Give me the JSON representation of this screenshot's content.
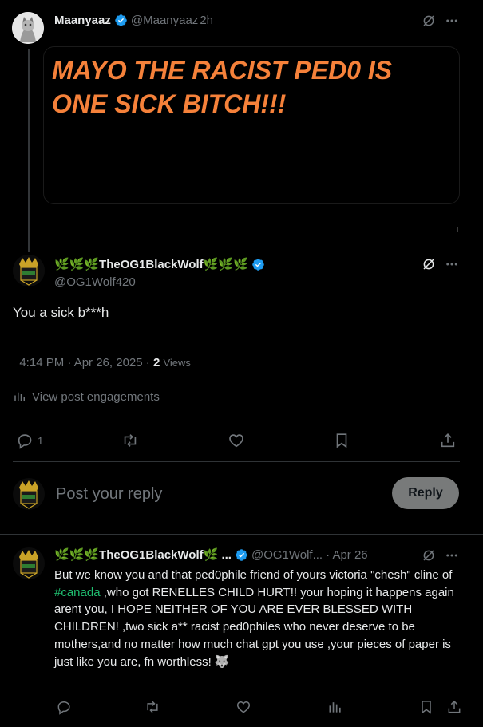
{
  "parent_post": {
    "display_name": "Maanyaaz",
    "handle": "@Maanyaaz",
    "time_ago": "2h",
    "headline_line1": "MAYO THE RACIST PED0 IS",
    "headline_line2": "ONE SICK BITCH!!!",
    "headline_color": "#f5813a"
  },
  "main_post": {
    "display_name": "🌿🌿🌿TheOG1BlackWolf🌿🌿🌿",
    "handle": "@OG1Wolf420",
    "text": "You a sick b***h",
    "timestamp": "4:14 PM · Apr 26, 2025 · ",
    "views_count": "2",
    "views_label": "Views",
    "engagements_label": "View post engagements",
    "reply_count": "1"
  },
  "composer": {
    "placeholder": "Post your reply",
    "reply_button": "Reply"
  },
  "reply_post": {
    "display_name": "🌿🌿🌿TheOG1BlackWolf🌿 ...",
    "handle": "@OG1Wolf...",
    "date": "· Apr 26",
    "text_before_tag": "But we know you and that ped0phile friend of yours victoria \"chesh\" cline of ",
    "hashtag": "#canada",
    "text_after_tag": " ,who got RENELLES CHILD HURT!! your hoping it happens again arent you, I HOPE NEITHER OF YOU ARE EVER BLESSED WITH CHILDREN! ,two sick a** racist ped0philes who never deserve to be mothers,and no matter how much chat gpt you use ,your pieces of paper is just like you are, fn worthless! 🐺"
  },
  "colors": {
    "background": "#000000",
    "text": "#e7e9ea",
    "muted": "#71767b",
    "verified": "#1d9bf0",
    "hashtag": "#1fbf70",
    "reply_button_bg": "#787a7a",
    "divider": "#2f3336"
  },
  "icons": [
    "verified-badge-icon",
    "grok-icon",
    "more-icon",
    "analytics-icon",
    "reply-icon",
    "repost-icon",
    "like-icon",
    "bookmark-icon",
    "share-icon"
  ]
}
